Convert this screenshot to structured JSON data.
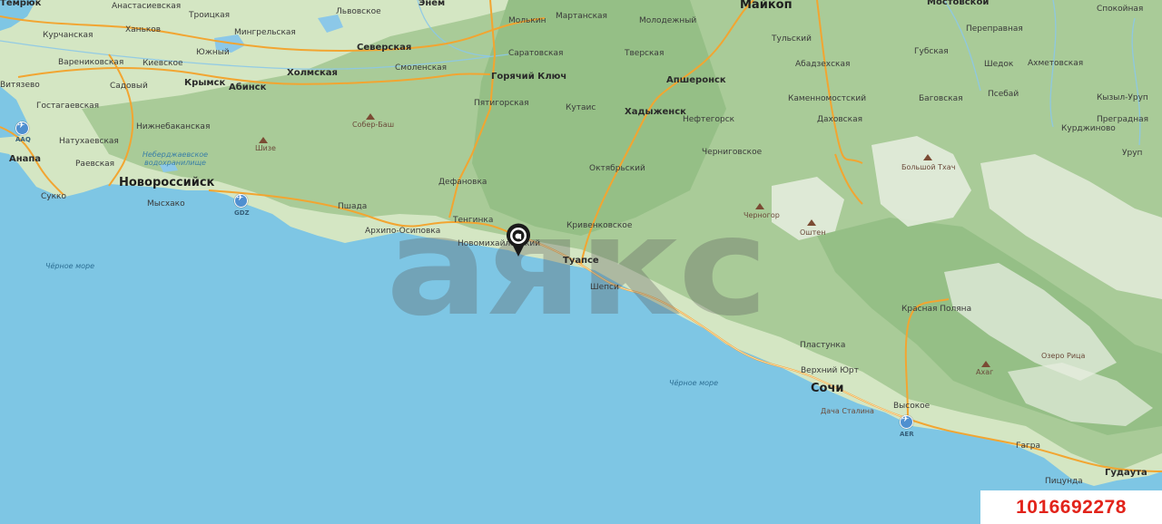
{
  "map": {
    "colors": {
      "sea": "#7ec6e4",
      "land": "#cfe3bf",
      "mountains": "#9fc490",
      "high_mountains": "#e9efe3",
      "roads": "#f2a531",
      "rivers": "#8cc8e8",
      "listing_id": "#e2231a"
    },
    "sea_labels": [
      "Чёрное море",
      "Чёрное море"
    ],
    "water_labels": [
      "Неберджаевское водохранилище"
    ],
    "cities": {
      "temryuk": "Темрюк",
      "anastasievskaya": "Анастасиевская",
      "troitskaya": "Троицкая",
      "lvovskoe": "Львовское",
      "enem": "Энем",
      "maikop": "Майкоп",
      "mostovskoi": "Мостовской",
      "spokoinaya": "Спокойная",
      "kurchanskaya": "Курчанская",
      "khankov": "Ханьков",
      "mingrelskaya": "Мингрельская",
      "severskaya": "Северская",
      "molkin": "Молькин",
      "martanskaya": "Мартанская",
      "molodezhny": "Молодежный",
      "tulsky": "Тульский",
      "yuzhny": "Южный",
      "saratovskaya": "Саратовская",
      "tverskaya": "Тверская",
      "abadzekhskaya": "Абадзехская",
      "gubskaya": "Губская",
      "perepravnaya": "Переправная",
      "varenikovskaya": "Варениковская",
      "kievskoe": "Киевское",
      "kholmskaya": "Холмская",
      "smolenskaya": "Смоленская",
      "shedok": "Шедок",
      "akhmetovskaya": "Ахметовская",
      "gostagaevskaya": "Гостагаевская",
      "sadovy": "Садовый",
      "krymsk": "Крымск",
      "abinsk": "Абинск",
      "goryachy_klyuch": "Горячий Ключ",
      "apsheronsk": "Апшеронск",
      "kamennomostsky": "Каменномостский",
      "psebai": "Псебай",
      "kyzyl_urup": "Кызыл-Уруп",
      "vityazevo": "Витязево",
      "pyatigorskaya": "Пятигорская",
      "kutais": "Кутаис",
      "khadyzhensk": "Хадыженск",
      "neftegorsk": "Нефтегорск",
      "bagovskaya": "Баговская",
      "pregradnaya": "Преградная",
      "nizhnebakanskaya": "Нижнебаканская",
      "dakhovskaya": "Даховская",
      "kurdzhinovo": "Курджиново",
      "natukhaevskaya": "Натухаевская",
      "urup": "Уруп",
      "chernigovskoe": "Черниговское",
      "anapa": "Анапа",
      "raevskaya": "Раевская",
      "oktyabrsky": "Октябрьский",
      "novorossiysk": "Новороссийск",
      "sukko": "Сукко",
      "defanovka": "Дефановка",
      "myskhako": "Мысхако",
      "pshada": "Пшада",
      "tenginka": "Тенгинка",
      "krivenkovskoe": "Кривенковское",
      "arkhipo_osipovka": "Архипо-Осиповка",
      "novomikhailovsky": "Новомихайловский",
      "tuapse": "Туапсе",
      "shepsi": "Шепси",
      "krasnaya_polyana": "Красная Поляна",
      "plastunka": "Пластунка",
      "verkhny_yurt": "Верхний Юрт",
      "sochi": "Сочи",
      "vysokoe": "Высокое",
      "gagra": "Гагра",
      "pitsunda": "Пицунда",
      "gudauta": "Гудаута"
    },
    "peaks": {
      "sober_bash": "Собер-Баш",
      "shize": "Шизе",
      "bolshoi_tkhach": "Большой Тхач",
      "chernogor": "Черногор",
      "oshten": "Оштен",
      "akhag": "Ахаг",
      "ozero_ritsa": "Озеро Рица",
      "dacha_stalina": "Дача Сталина"
    },
    "airports": [
      {
        "code": "AAQ",
        "icon": "airplane-icon"
      },
      {
        "code": "GDZ",
        "icon": "airplane-icon"
      },
      {
        "code": "AER",
        "icon": "airplane-icon"
      }
    ],
    "marker": {
      "icon": "location-pin-icon"
    },
    "watermark": "аякс"
  },
  "listing_id": "1016692278"
}
